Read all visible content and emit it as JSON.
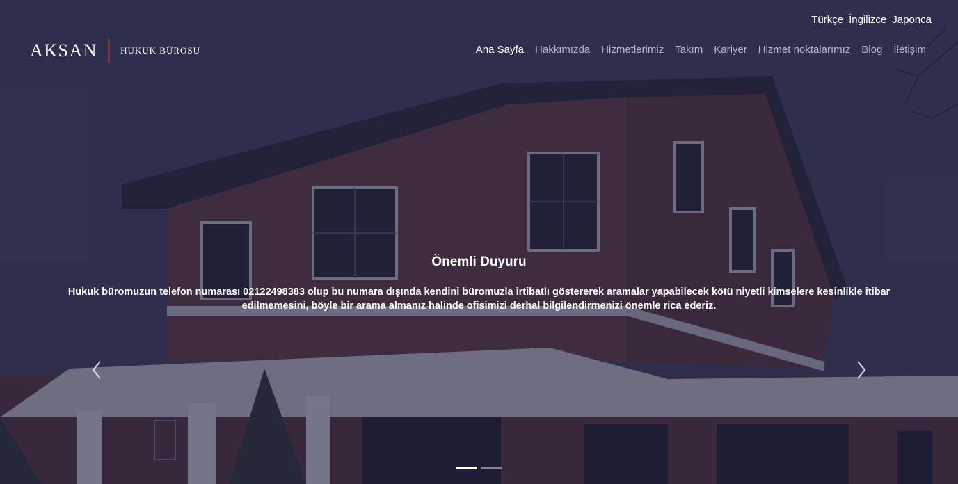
{
  "languages": [
    "Türkçe",
    "İngilizce",
    "Japonca"
  ],
  "logo": {
    "main": "AKSAN",
    "sub": "HUKUK BÜROSU"
  },
  "nav": {
    "items": [
      "Ana Sayfa",
      "Hakkımızda",
      "Hizmetlerimiz",
      "Takım",
      "Kariyer",
      "Hizmet noktalarımız",
      "Blog",
      "İletişim"
    ],
    "active_index": 0
  },
  "slide": {
    "title": "Önemli Duyuru",
    "text": "Hukuk büromuzun telefon numarası 02122498383 olup bu numara dışında kendini büromuzla irtibatlı göstererek aramalar yapabilecek kötü niyetli kimselere kesinlikle itibar edilmemesini, böyle bir arama almanız halinde ofisimizi derhal bilgilendirmenizi önemle rica ederiz."
  },
  "carousel": {
    "prev_icon": "chevron-left-icon",
    "next_icon": "chevron-right-icon",
    "slide_count": 2,
    "active_slide": 1
  },
  "colors": {
    "accent": "#b0193b",
    "overlay": "#1c1a3a",
    "nav_inactive": "#b9b8cc",
    "text": "#ffffff"
  }
}
